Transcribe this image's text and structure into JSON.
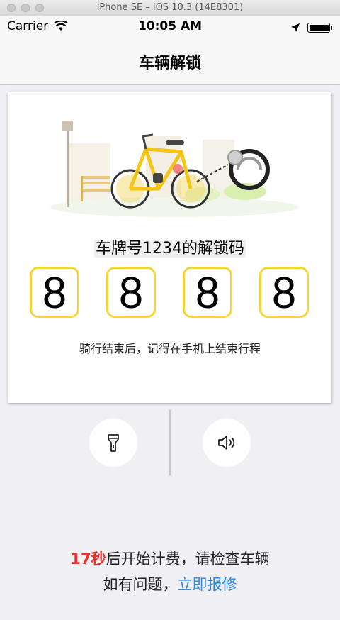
{
  "simulator": {
    "title": "iPhone SE – iOS 10.3 (14E8301)"
  },
  "status_bar": {
    "carrier": "Carrier",
    "time": "10:05 AM"
  },
  "nav": {
    "title": "车辆解锁"
  },
  "card": {
    "plate_label": "车牌号1234的解锁码",
    "code_digits": [
      "8",
      "8",
      "8",
      "8"
    ],
    "hint": "骑行结束后，记得在手机上结束行程"
  },
  "actions": [
    {
      "icon": "flashlight-icon"
    },
    {
      "icon": "speaker-icon"
    }
  ],
  "footer": {
    "countdown_value": "17秒",
    "countdown_suffix": "后开始计费，请检查车辆",
    "problem_text": "如有问题，",
    "repair_link": "立即报修"
  },
  "colors": {
    "accent_yellow": "#f5d33b",
    "countdown_red": "#e8322b",
    "link_blue": "#2b8ae0",
    "background": "#efeff4"
  }
}
